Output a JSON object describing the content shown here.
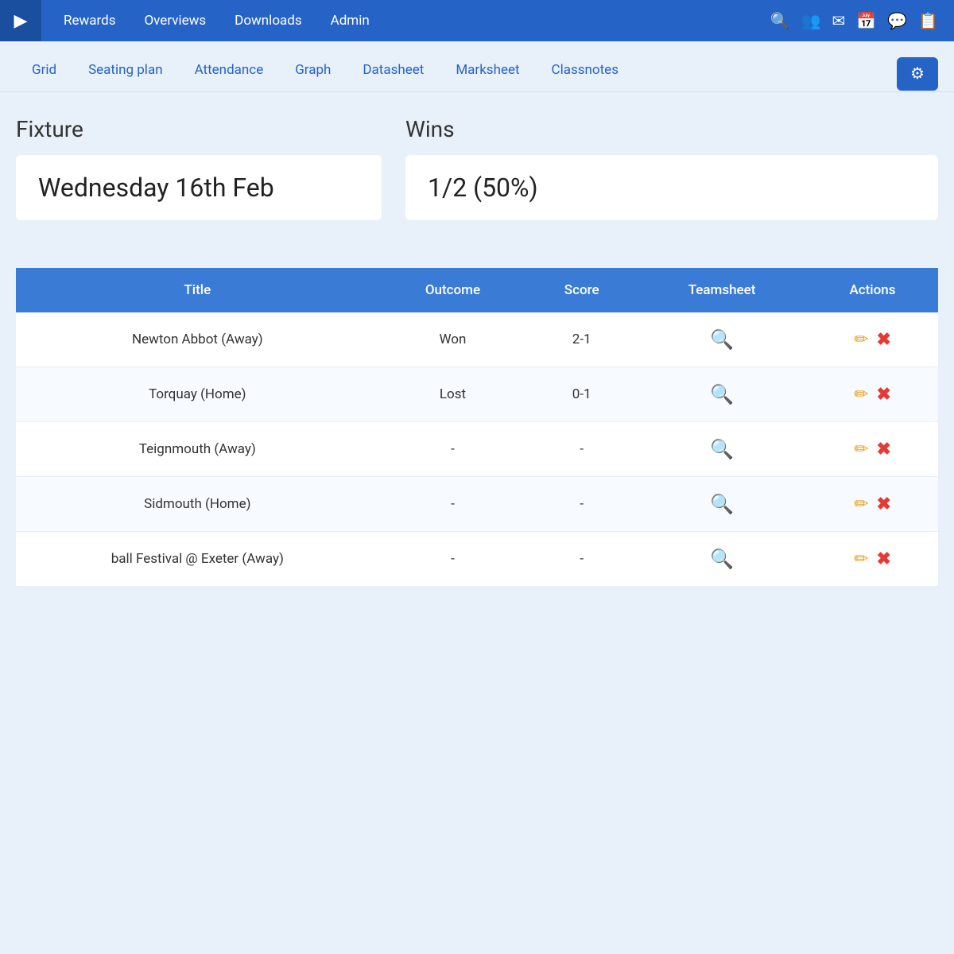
{
  "nav": {
    "brand_icon": "▶",
    "links": [
      "Rewards",
      "Overviews",
      "Downloads",
      "Admin"
    ],
    "icons": [
      "search",
      "users",
      "envelope",
      "calendar",
      "chat",
      "inbox"
    ]
  },
  "sub_nav": {
    "tabs": [
      "Grid",
      "Seating plan",
      "Attendance",
      "Graph",
      "Datasheet",
      "Marksheet",
      "Classnotes"
    ],
    "settings_icon": "⚙"
  },
  "stats": {
    "fixture_label": "Fixture",
    "fixture_value": "Wednesday 16th Feb",
    "wins_label": "Wins",
    "wins_value": "1/2 (50%)"
  },
  "table": {
    "headers": [
      "Title",
      "Outcome",
      "Score",
      "Teamsheet",
      "Actions"
    ],
    "rows": [
      {
        "title": "Newton Abbot (Away)",
        "outcome": "Won",
        "score": "2-1",
        "has_teamsheet": true
      },
      {
        "title": "Torquay (Home)",
        "outcome": "Lost",
        "score": "0-1",
        "has_teamsheet": true
      },
      {
        "title": "Teignmouth (Away)",
        "outcome": "-",
        "score": "-",
        "has_teamsheet": true
      },
      {
        "title": "Sidmouth (Home)",
        "outcome": "-",
        "score": "-",
        "has_teamsheet": true
      },
      {
        "title": "ball Festival @ Exeter (Away)",
        "outcome": "-",
        "score": "-",
        "has_teamsheet": true
      }
    ]
  }
}
